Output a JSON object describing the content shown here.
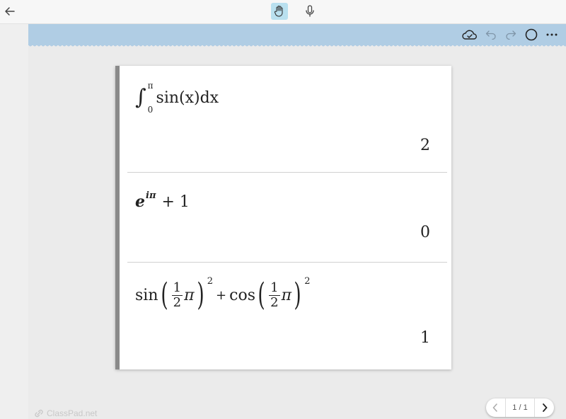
{
  "cells": [
    {
      "expression": {
        "upper_limit": "π",
        "lower_limit": "0",
        "integrand": "sin(x)dx"
      },
      "result": "2"
    },
    {
      "expression": {
        "base": "e",
        "exponent": "iπ",
        "rest": "+ 1"
      },
      "result": "0"
    },
    {
      "expression": {
        "fn1": "sin",
        "fn2": "cos",
        "frac_num": "1",
        "frac_den": "2",
        "pi": "π",
        "power": "2",
        "plus": "+"
      },
      "result": "1"
    }
  ],
  "pager": {
    "count": "1 / 1"
  },
  "watermark": "ClassPad.net",
  "colors": {
    "toolbar": "#b0cde4",
    "active_tool": "#b9e0ef",
    "card_accent": "#8a8a8a"
  },
  "icons": {
    "back": "arrow-left-icon",
    "hand": "hand-icon",
    "mic": "microphone-icon",
    "cloud": "cloud-check-icon",
    "undo": "undo-icon",
    "redo": "redo-icon",
    "circle": "circle-icon",
    "more": "more-horizontal-icon"
  }
}
